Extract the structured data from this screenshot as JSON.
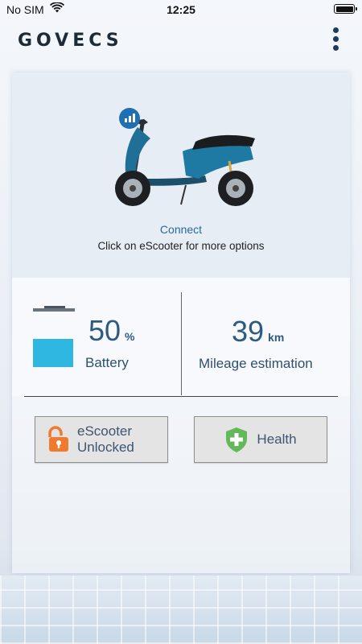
{
  "status_bar": {
    "carrier": "No SIM",
    "time": "12:25"
  },
  "header": {
    "brand": "GOVECS"
  },
  "scooter": {
    "connect_label": "Connect",
    "hint": "Click on eScooter for more options"
  },
  "stats": {
    "battery": {
      "value": "50",
      "unit": "%",
      "label": "Battery",
      "level": 0.5
    },
    "mileage": {
      "value": "39",
      "unit": "km",
      "label": "Mileage estimation"
    }
  },
  "buttons": {
    "lock": {
      "line1": "eScooter",
      "line2": "Unlocked"
    },
    "health": {
      "label": "Health"
    }
  },
  "colors": {
    "accent": "#1f6fb2",
    "battery_fill": "#2fb7e2",
    "unlock_icon": "#f07a2e",
    "health_icon": "#63b95a",
    "text_blue": "#2f5a80"
  },
  "icons": [
    "wifi-icon",
    "battery-status-icon",
    "more-vertical-icon",
    "signal-bars-icon",
    "padlock-open-icon",
    "shield-plus-icon"
  ]
}
